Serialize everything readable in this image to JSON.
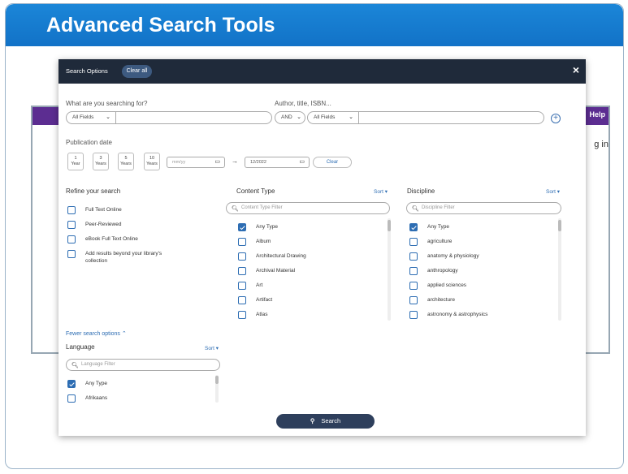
{
  "slide": {
    "title": "Advanced Search Tools"
  },
  "background_app": {
    "help": "Help",
    "login": "g in"
  },
  "modal": {
    "title": "Search Options",
    "clear_all": "Clear all",
    "close": "×",
    "query": {
      "label": "What are you searching for?",
      "field_select": "All Fields",
      "value": ""
    },
    "author": {
      "label": "Author, title, ISBN...",
      "operator": "AND",
      "field_select": "All Fields",
      "value": ""
    },
    "publication_date": {
      "label": "Publication date",
      "years": [
        {
          "num": "1",
          "unit": "Year"
        },
        {
          "num": "3",
          "unit": "Years"
        },
        {
          "num": "5",
          "unit": "Years"
        },
        {
          "num": "10",
          "unit": "Years"
        }
      ],
      "from_placeholder": "mm/yy",
      "to_value": "12/2022",
      "clear": "Clear"
    },
    "refine": {
      "title": "Refine your search",
      "items": [
        "Full Text Online",
        "Peer-Reviewed",
        "eBook Full Text Online",
        "Add results beyond your library's",
        "collection"
      ]
    },
    "content_type": {
      "title": "Content Type",
      "sort": "Sort",
      "filter_placeholder": "Content Type Filter",
      "items": [
        "Any Type",
        "Album",
        "Architectural Drawing",
        "Archival Material",
        "Art",
        "Artifact",
        "Atlas"
      ]
    },
    "discipline": {
      "title": "Discipline",
      "sort": "Sort",
      "filter_placeholder": "Discipline Filter",
      "items": [
        "Any Type",
        "agriculture",
        "anatomy & physiology",
        "anthropology",
        "applied sciences",
        "architecture",
        "astronomy & astrophysics"
      ]
    },
    "fewer_options": "Fewer search options",
    "language": {
      "title": "Language",
      "sort": "Sort",
      "filter_placeholder": "Language Filter",
      "items": [
        "Any Type",
        "Afrikaans"
      ]
    },
    "search_button": "Search"
  }
}
